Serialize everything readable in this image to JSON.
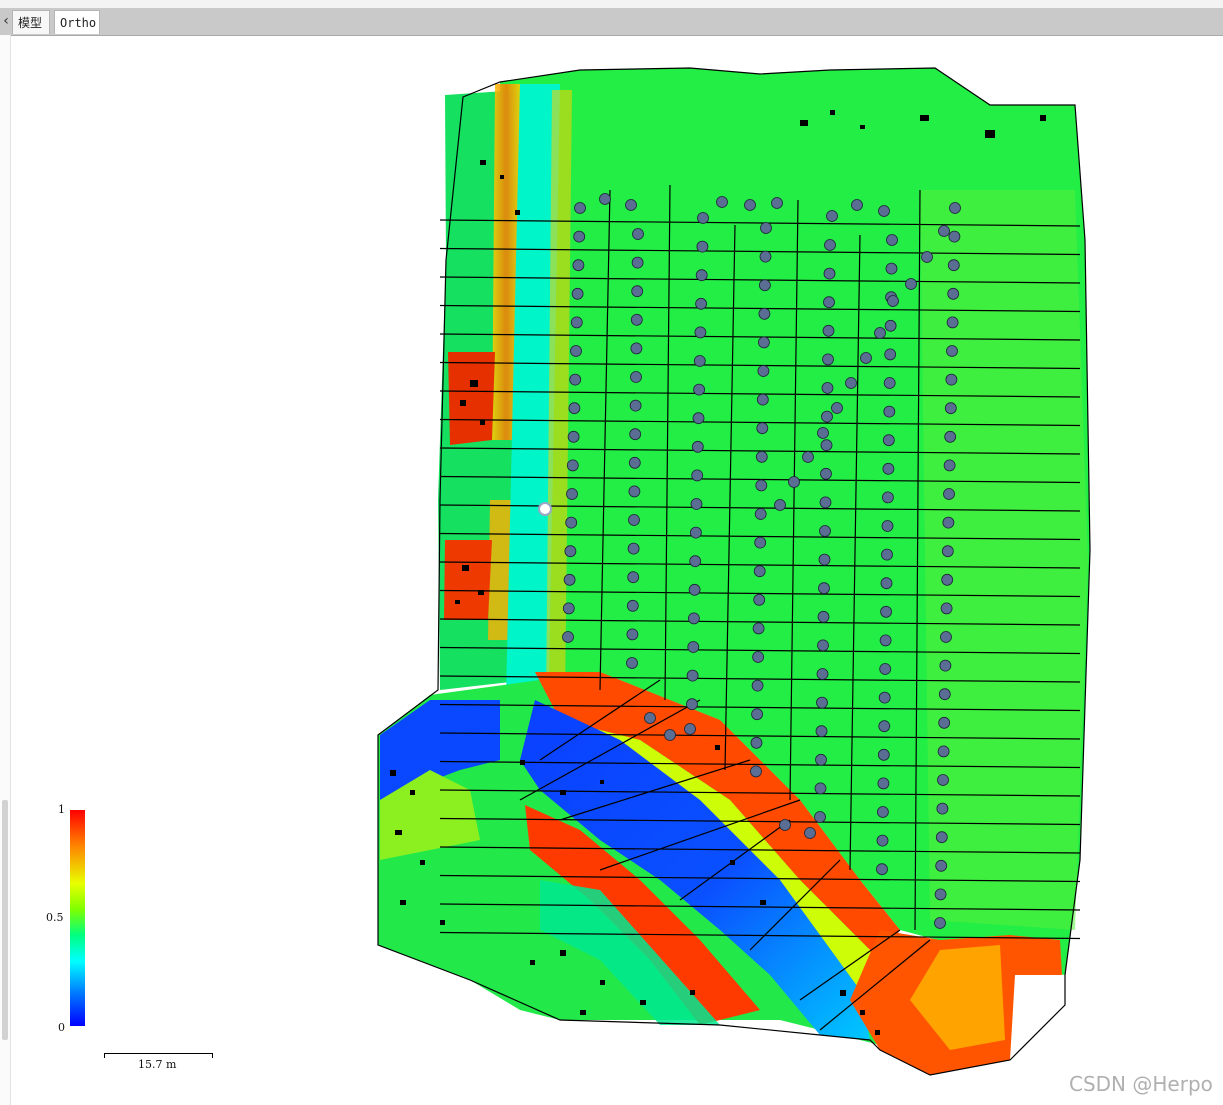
{
  "tabs": [
    {
      "label": "模型"
    },
    {
      "label": "Ortho"
    }
  ],
  "legend": {
    "max_label": "1",
    "mid_label": "0.5",
    "min_label": "0",
    "colormap": [
      "#0000ff",
      "#0080ff",
      "#00ffff",
      "#00ff80",
      "#7fff00",
      "#e8ff00",
      "#ff8000",
      "#ff0000"
    ]
  },
  "scale_bar": {
    "label": "15.7 m"
  },
  "watermark": "CSDN @Herpo",
  "icons": {
    "tab_back": "chevron-left-icon"
  },
  "colors": {
    "field_green": "#20ef40",
    "water_blue": "#0a40ff",
    "bank_red": "#ff3000",
    "marker": "#5a6e94"
  }
}
